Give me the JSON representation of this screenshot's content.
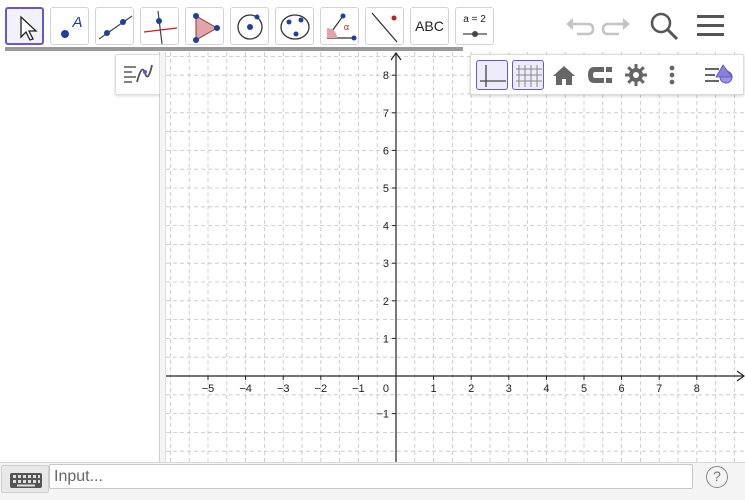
{
  "toolbar": {
    "tools": [
      {
        "name": "move-tool",
        "selected": true
      },
      {
        "name": "point-tool",
        "label": "A"
      },
      {
        "name": "line-tool"
      },
      {
        "name": "perpendicular-line-tool"
      },
      {
        "name": "polygon-tool"
      },
      {
        "name": "circle-center-point-tool"
      },
      {
        "name": "conic-through-points-tool"
      },
      {
        "name": "angle-tool",
        "label": "α"
      },
      {
        "name": "reflect-tool"
      },
      {
        "name": "text-tool",
        "label": "ABC"
      },
      {
        "name": "slider-tool",
        "label": "a = 2"
      }
    ],
    "undo_icon": "undo-icon",
    "redo_icon": "redo-icon",
    "search_icon": "search-icon",
    "menu_icon": "hamburger-menu-icon"
  },
  "graphics": {
    "x_ticks": [
      "−5",
      "−4",
      "−3",
      "−2",
      "−1",
      "1",
      "2",
      "3",
      "4",
      "5",
      "6",
      "7",
      "8"
    ],
    "y_ticks": [
      "8",
      "7",
      "6",
      "5",
      "4",
      "3",
      "2",
      "1",
      "−1"
    ],
    "origin_label": "0",
    "x_range": [
      -6,
      9
    ],
    "y_range": [
      -2,
      9
    ],
    "grid": true,
    "axes": true
  },
  "style_bar": {
    "buttons": [
      "show-axes-icon",
      "show-grid-icon",
      "home-icon",
      "point-capturing-icon",
      "settings-gear-icon",
      "more-vertical-icon",
      "style-bar-menu-icon"
    ],
    "active": [
      "show-axes-icon",
      "show-grid-icon"
    ]
  },
  "input_bar": {
    "placeholder": "Input...",
    "help_label": "?"
  },
  "colors": {
    "accent": "#6557d2",
    "tool_blue": "#1c3fa0",
    "axis": "#222222",
    "grid": "#c4c4c4"
  }
}
